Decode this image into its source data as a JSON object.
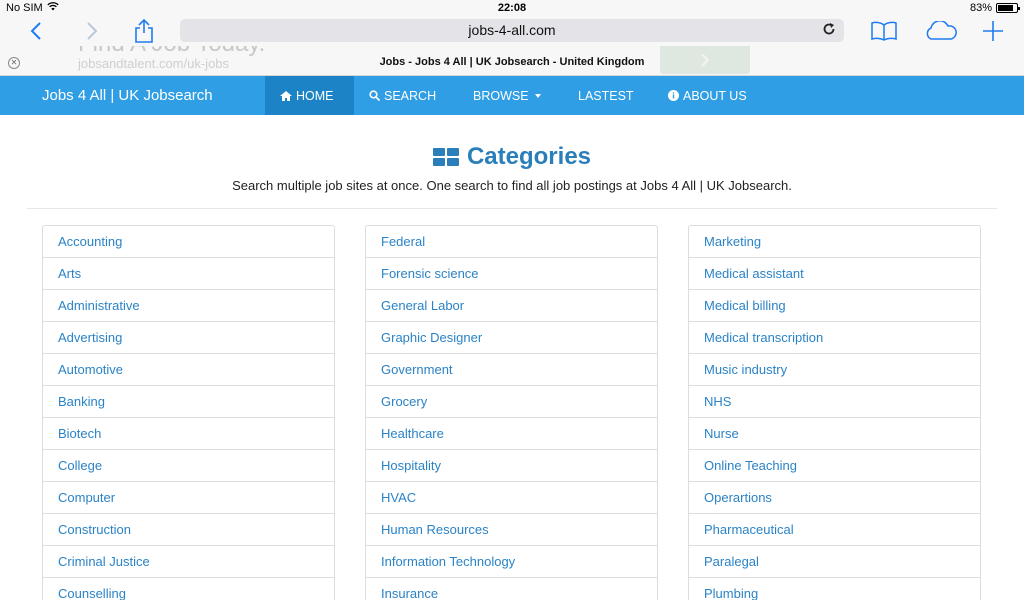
{
  "status": {
    "carrier": "No SIM",
    "time": "22:08",
    "battery": "83%",
    "battery_level": 0.83
  },
  "browser": {
    "url": "jobs-4-all.com",
    "page_title": "Jobs - Jobs 4 All | UK Jobsearch - United Kingdom"
  },
  "ghost": {
    "headline": "Find A Job Today.",
    "link": "jobsandtalent.com/uk-jobs"
  },
  "navbar": {
    "brand": "Jobs 4 All | UK Jobsearch",
    "home": "HOME",
    "search": "SEARCH",
    "browse": "BROWSE",
    "lastest": "LASTEST",
    "about": "ABOUT US"
  },
  "header": {
    "title": "Categories",
    "subtitle": "Search multiple job sites at once. One search to find all job postings at Jobs 4 All | UK Jobsearch."
  },
  "categories": {
    "col1": [
      "Accounting",
      "Arts",
      "Administrative",
      "Advertising",
      "Automotive",
      "Banking",
      "Biotech",
      "College",
      "Computer",
      "Construction",
      "Criminal Justice",
      "Counselling"
    ],
    "col2": [
      "Federal",
      "Forensic science",
      "General Labor",
      "Graphic Designer",
      "Government",
      "Grocery",
      "Healthcare",
      "Hospitality",
      "HVAC",
      "Human Resources",
      "Information Technology",
      "Insurance"
    ],
    "col3": [
      "Marketing",
      "Medical assistant",
      "Medical billing",
      "Medical transcription",
      "Music industry",
      "NHS",
      "Nurse",
      "Online Teaching",
      "Operartions",
      "Pharmaceutical",
      "Paralegal",
      "Plumbing"
    ]
  },
  "colors": {
    "nav_bg": "#2f9ee4",
    "nav_active": "#1c84c6",
    "link": "#2a83c7",
    "heading": "#2a7fba",
    "ios_blue": "#1e7cf2"
  }
}
